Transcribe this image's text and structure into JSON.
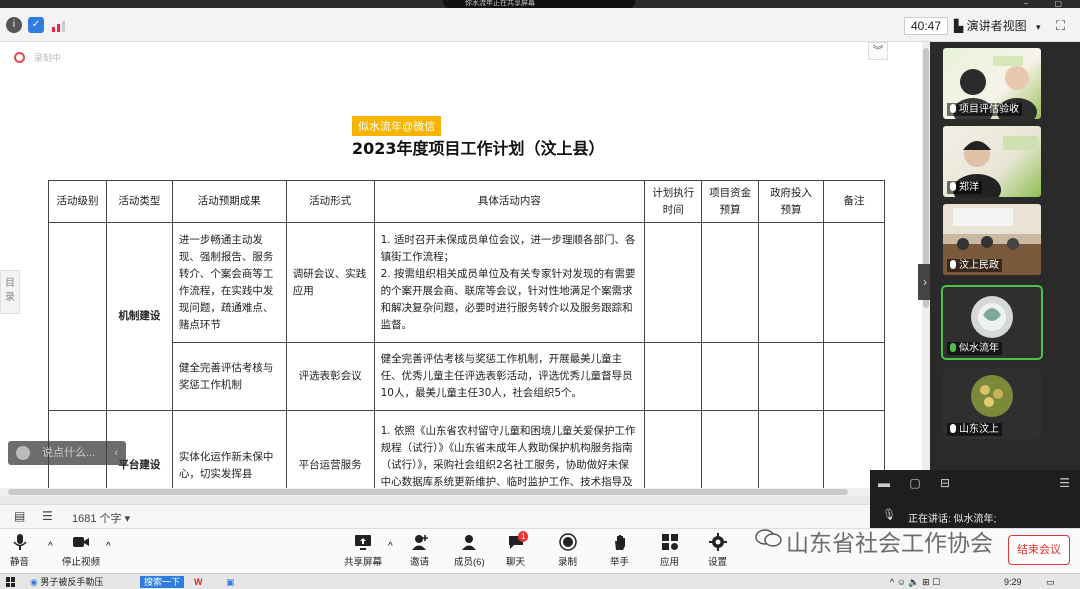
{
  "topbar": {
    "share_text": "你水流年正在共享屏幕"
  },
  "toolbar": {
    "timer": "40:47",
    "view_mode": "演讲者视图",
    "record_status": "录制中"
  },
  "document": {
    "watermark_tag": "似水流年@微信",
    "title": "2023年度项目工作计划（汶上县）",
    "side_tab": "目录",
    "word_count": "1681 个字",
    "headers": [
      "活动级别",
      "活动类型",
      "活动预期成果",
      "活动形式",
      "具体活动内容",
      "计划执行时间",
      "项目资金预算",
      "政府投入预算",
      "备注"
    ],
    "rows": [
      {
        "type": "机制建设",
        "outcome": "进一步畅通主动发现、强制报告、服务转介、个案会商等工作流程，在实践中发现问题，疏通难点、赌点环节",
        "form": "调研会议、实践应用",
        "content": "1. 适时召开未保成员单位会议，进一步理顺各部门、各镇街工作流程；\n2. 按需组织相关成员单位及有关专家针对发现的有需要的个案开展会商、联席等会议，针对性地满足个案需求和解决复杂问题，必要时进行服务转介以及服务跟踪和监督。"
      },
      {
        "type": "",
        "outcome": "健全完善评估考核与奖惩工作机制",
        "form": "评选表彰会议",
        "content": "健全完善评估考核与奖惩工作机制，开展最美儿童主任、优秀儿童主任评选表彰活动，评选优秀儿童督导员10人，最美儿童主任30人，社会组织5个。"
      },
      {
        "type": "平台建设",
        "outcome": "实体化运作新未保中心，切实发挥县",
        "form": "平台运营服务",
        "content": "1. 依照《山东省农村留守儿童和困境儿童关爱保护工作规程（试行）》《山东省未成年人救助保护机构服务指南（试行）》，采购社会组织2名社工服务，协助做好未保中心数据库系统更新维护、临时监护工作、技术指导及督导等相关服务。"
      }
    ]
  },
  "chat_popup": {
    "placeholder": "说点什么..."
  },
  "participants": [
    {
      "name": "项目评估验收",
      "video": "two women in conference room"
    },
    {
      "name": "郑洋",
      "video": "woman in conference room"
    },
    {
      "name": "汶上民政",
      "video": "meeting room"
    },
    {
      "name": "似水流年",
      "video": "avatar"
    },
    {
      "name": "山东汶上",
      "video": "avatar"
    }
  ],
  "speaker": {
    "speaking_label": "正在讲话: 似水流年;"
  },
  "meeting_toolbar": {
    "mute": "静音",
    "stop_video": "停止视频",
    "share": "共享屏幕",
    "invite": "邀请",
    "members": "成员(6)",
    "chat": "聊天",
    "chat_badge": "1",
    "record": "录制",
    "raise_hand": "举手",
    "apps": "应用",
    "settings": "设置",
    "end": "结束会议"
  },
  "brand_watermark": "山东省社会工作协会",
  "taskbar": {
    "item1": "男子被反手勒压",
    "search": "搜索一下",
    "clock": "9:29"
  },
  "colors": {
    "record_red": "#e94b4b",
    "tag_yellow": "#f5b400",
    "active_green": "#4cc24c",
    "end_red": "#d33333"
  }
}
